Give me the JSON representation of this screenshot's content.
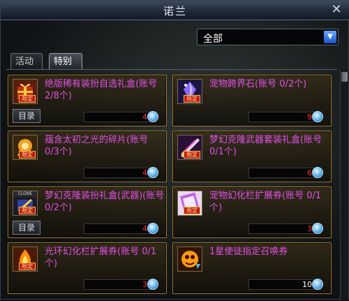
{
  "window": {
    "title": "诺兰",
    "close_glyph": "✕"
  },
  "filter": {
    "selected": "全部",
    "arrow_glyph": "▼"
  },
  "tabs": [
    {
      "label": "活动",
      "active": false
    },
    {
      "label": "特别",
      "active": true
    }
  ],
  "items": [
    {
      "name": "绝版稀有装扮自选礼盒(账号 2/8个)",
      "limit_tag": "限定",
      "icon": "gift-box-icon",
      "catalog": "目录",
      "quantity": "4"
    },
    {
      "name": "宠物跨界石(账号 0/2个)",
      "limit_tag": "限定",
      "icon": "crystal-icon",
      "catalog": "",
      "quantity": "9"
    },
    {
      "name": "蕴含太初之光的碎片(账号 0/3个)",
      "limit_tag": "限定",
      "icon": "light-fragment-icon",
      "catalog": "",
      "quantity": "4"
    },
    {
      "name": "梦幻克隆武器套装礼盒(账号 0/1个)",
      "limit_tag": "限定",
      "icon": "weapon-box-icon",
      "catalog": "",
      "quantity": "6"
    },
    {
      "name": "梦幻克隆装扮礼盒(武器)(账号 0/2个)",
      "limit_tag": "限定",
      "clone_tag": "CLONE",
      "icon": "clone-box-icon",
      "catalog": "目录",
      "quantity": "4"
    },
    {
      "name": "宠物幻化栏扩展券(账号 0/1个)",
      "limit_tag": "限定",
      "icon": "pet-ticket-icon",
      "catalog": "",
      "quantity": "3"
    },
    {
      "name": "光环幻化栏扩展券(账号 0/1个)",
      "limit_tag": "限定",
      "icon": "aura-ticket-icon",
      "catalog": "",
      "quantity": "3"
    },
    {
      "name": "1星使徒指定召唤券",
      "limit_tag": "",
      "icon": "apostle-summon-icon",
      "catalog": "",
      "quantity": "10"
    }
  ],
  "colors": {
    "item_name": "#e050e8",
    "quantity": "#ff3030",
    "card_border": "#a0782a",
    "limit_tag_bg": "#c01818"
  }
}
